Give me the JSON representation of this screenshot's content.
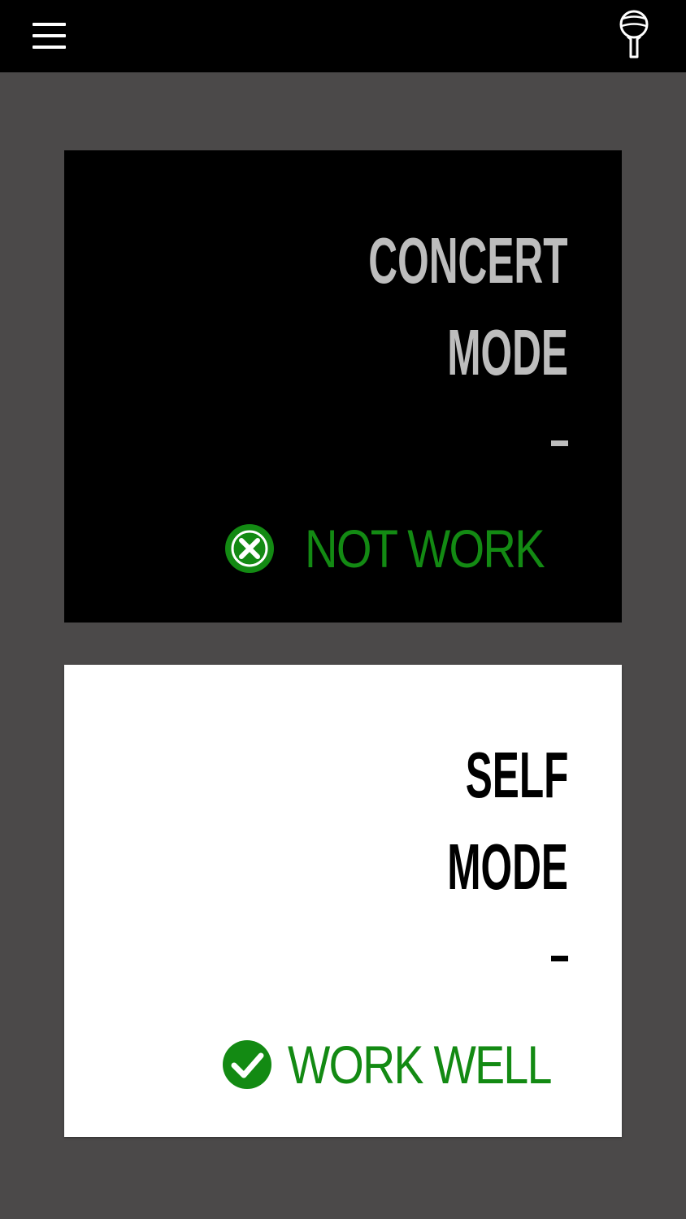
{
  "header": {
    "menu_icon": "hamburger-menu-icon",
    "mic_icon": "microphone-icon",
    "background": "#000000"
  },
  "cards": {
    "concert": {
      "line1": "CONCERT",
      "line2": "MODE",
      "dash": "-",
      "status_icon": "x-circle-icon",
      "status": "NOT WORK",
      "background": "#000000",
      "text_color": "#bdbdbd",
      "status_color": "#138a13"
    },
    "self": {
      "line1": "SELF",
      "line2": "MODE",
      "dash": "-",
      "status_icon": "check-circle-icon",
      "status": "WORK WELL",
      "background": "#ffffff",
      "text_color": "#000000",
      "status_color": "#138a13"
    }
  },
  "colors": {
    "page_background": "#4b4949"
  }
}
